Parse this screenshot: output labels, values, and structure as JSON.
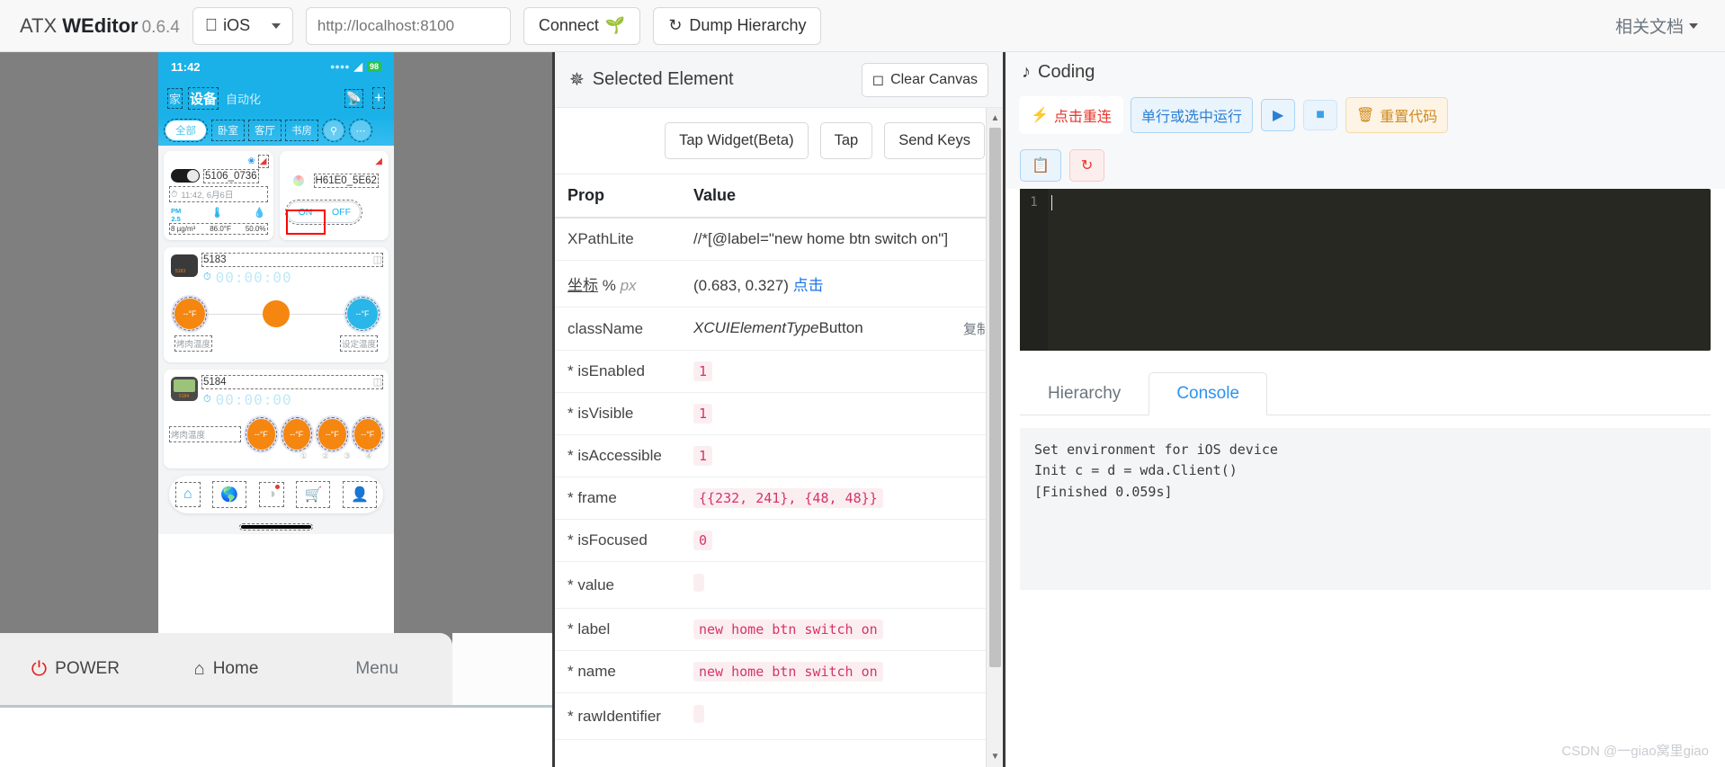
{
  "topbar": {
    "app_name_prefix": "ATX ",
    "app_name_bold": "WEditor",
    "version": "0.6.4",
    "platform_label": "iOS",
    "platform_icon": "apple-icon",
    "url_placeholder": "http://localhost:8100",
    "url_value": "",
    "connect_label": "Connect",
    "connect_icon": "sprout-icon",
    "dump_label": "Dump Hierarchy",
    "dump_icon": "refresh-icon",
    "docs_label": "相关文档"
  },
  "device": {
    "status_time": "11:42",
    "wifi_icon": "wifi-icon",
    "battery_text": "98",
    "nav": {
      "tab_home": "家",
      "tab_device": "设备",
      "tab_automation": "自动化",
      "icon_router": "router-icon",
      "icon_add": "plus-icon"
    },
    "chips": [
      "全部",
      "卧室",
      "客厅",
      "书房"
    ],
    "chip_active": "全部",
    "chip_search_icon": "search-icon",
    "chip_more_icon": "ellipsis-icon",
    "card1": {
      "name": "5106_0736",
      "bluetooth_icon": "bluetooth-icon",
      "wifi_icon": "wifi-red-icon",
      "time": "11:42, 6月6日",
      "clock_icon": "clock-icon",
      "sensors": [
        {
          "label": "PM\n2.5",
          "value": "8 µg/m³"
        },
        {
          "label": "temp-icon",
          "value": "86.0°F"
        },
        {
          "label": "humidity-icon",
          "value": "50.0%"
        }
      ]
    },
    "card2": {
      "name": "H61E0_5E62",
      "wifi_icon": "wifi-red-icon",
      "on_label": "ON",
      "off_label": "OFF"
    },
    "card3": {
      "name": "5183",
      "timer": "00:00:00",
      "left_temp": "--°F",
      "right_temp": "--°F",
      "left_label": "烤肉温度",
      "right_label": "设定温度"
    },
    "card4": {
      "name": "5184",
      "timer": "00:00:00",
      "probe_label": "烤肉温度",
      "probes": [
        "--°F",
        "--°F",
        "--°F",
        "--°F"
      ],
      "probe_numbers": [
        "①",
        "②",
        "③",
        "④"
      ]
    },
    "tabbar": [
      "home-icon",
      "globe-icon",
      "compass-icon",
      "cart-icon",
      "person-icon"
    ],
    "tabbar_active": "home-icon"
  },
  "hardware": {
    "power_label": "POWER",
    "power_icon": "power-icon",
    "home_label": "Home",
    "home_icon": "home-icon",
    "menu_label": "Menu"
  },
  "selected_element": {
    "title": "Selected Element",
    "title_icon": "target-icon",
    "clear_canvas_label": "Clear Canvas",
    "clear_canvas_icon": "square-icon",
    "actions": [
      "Tap Widget(Beta)",
      "Tap",
      "Send Keys"
    ],
    "table_headers": [
      "Prop",
      "Value"
    ],
    "rows": [
      {
        "prop": "XPathLite",
        "value": "//*[@label=\"new home btn switch on\"]",
        "style": "plain"
      },
      {
        "prop": "坐标 % px",
        "value": "(0.683, 0.327)",
        "link": "点击",
        "style": "coord"
      },
      {
        "prop": "className",
        "value_italic": "XCUIElementType",
        "value_rest": "Button",
        "extra": "复制",
        "style": "classname"
      },
      {
        "prop": "* isEnabled",
        "value": "1",
        "style": "code"
      },
      {
        "prop": "* isVisible",
        "value": "1",
        "style": "code"
      },
      {
        "prop": "* isAccessible",
        "value": "1",
        "style": "code"
      },
      {
        "prop": "* frame",
        "value": "{{232, 241}, {48, 48}}",
        "style": "code"
      },
      {
        "prop": "* isFocused",
        "value": "0",
        "style": "code"
      },
      {
        "prop": "* value",
        "value": "",
        "style": "code"
      },
      {
        "prop": "* label",
        "value": "new home btn switch on",
        "style": "code"
      },
      {
        "prop": "* name",
        "value": "new home btn switch on",
        "style": "code"
      },
      {
        "prop": "* rawIdentifier",
        "value": "",
        "style": "code"
      }
    ]
  },
  "coding": {
    "title": "Coding",
    "title_icon": "music-note-icon",
    "reconnect_label": "点击重连",
    "reconnect_icon": "broken-link-icon",
    "run_selection_label": "单行或选中运行",
    "play_icon": "play-icon",
    "stop_icon": "stop-icon",
    "reset_label": "重置代码",
    "reset_icon": "trash-icon",
    "copy_icon": "copy-icon",
    "refresh_icon": "refresh-cw-icon",
    "editor_line_number": "1",
    "editor_content": "",
    "tabs": [
      "Hierarchy",
      "Console"
    ],
    "active_tab": "Console",
    "console_lines": [
      "Set environment for iOS device",
      "Init c = d = wda.Client()",
      "[Finished 0.059s]"
    ]
  },
  "watermark": "CSDN @一giao窝里giao",
  "colors": {
    "accent_blue": "#19b1e8",
    "orange": "#f5860f",
    "selection_red": "#ff0000",
    "code_pink": "#d6336c",
    "link_blue": "#1a73e8"
  }
}
